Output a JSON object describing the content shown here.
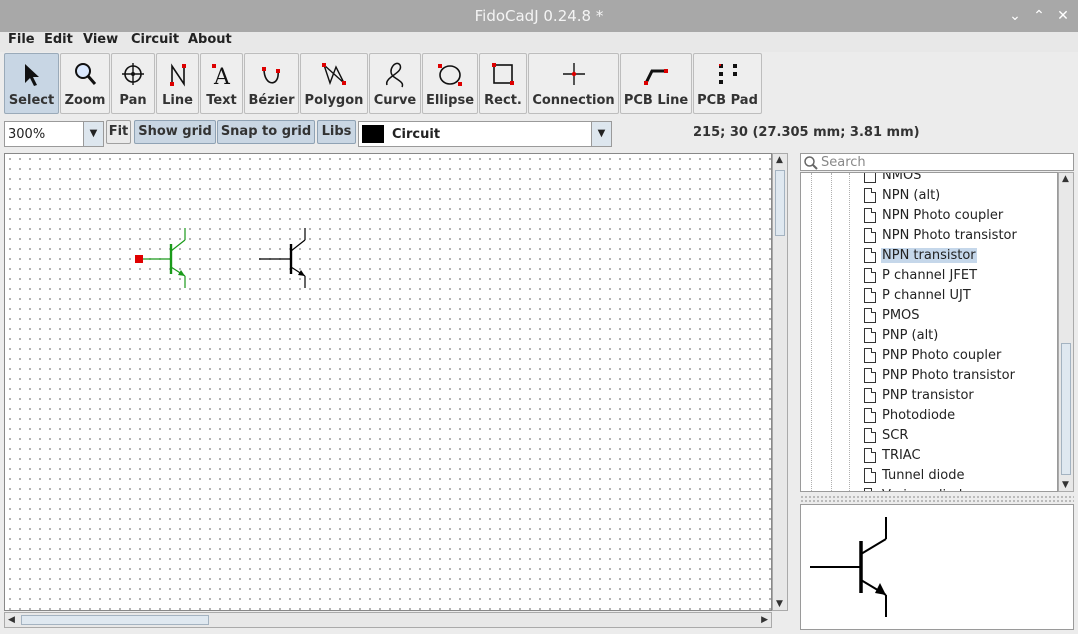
{
  "window": {
    "title": "FidoCadJ 0.24.8  *",
    "buttons": [
      "minimize",
      "maximize",
      "close"
    ]
  },
  "menu": [
    "File",
    "Edit",
    "View",
    "Circuit",
    "About"
  ],
  "toolbar": {
    "tools": [
      {
        "label": "Select",
        "icon": "arrow-cursor-icon",
        "active": true
      },
      {
        "label": "Zoom",
        "icon": "magnifier-icon"
      },
      {
        "label": "Pan",
        "icon": "crosshair-icon"
      },
      {
        "label": "Line",
        "icon": "line-icon"
      },
      {
        "label": "Text",
        "icon": "text-a-icon"
      },
      {
        "label": "Bézier",
        "icon": "bezier-icon"
      },
      {
        "label": "Polygon",
        "icon": "polygon-icon"
      },
      {
        "label": "Curve",
        "icon": "curve-icon"
      },
      {
        "label": "Ellipse",
        "icon": "ellipse-icon"
      },
      {
        "label": "Rect.",
        "icon": "rectangle-icon"
      },
      {
        "label": "Connection",
        "icon": "connection-icon"
      },
      {
        "label": "PCB Line",
        "icon": "pcb-line-icon"
      },
      {
        "label": "PCB Pad",
        "icon": "pcb-pad-icon"
      }
    ]
  },
  "toolbar2": {
    "zoom_value": "300%",
    "fit_label": "Fit",
    "show_grid_label": "Show grid",
    "snap_to_grid_label": "Snap to grid",
    "libs_label": "Libs",
    "layer_value": "Circuit",
    "layer_color": "#000000",
    "coordinates": "215; 30 (27.305 mm; 3.81 mm)"
  },
  "library": {
    "search_placeholder": "Search",
    "items": [
      {
        "label": "NMOS"
      },
      {
        "label": "NPN (alt)"
      },
      {
        "label": "NPN Photo coupler"
      },
      {
        "label": "NPN Photo transistor"
      },
      {
        "label": "NPN transistor",
        "selected": true
      },
      {
        "label": "P channel JFET"
      },
      {
        "label": "P channel UJT"
      },
      {
        "label": "PMOS"
      },
      {
        "label": "PNP (alt)"
      },
      {
        "label": "PNP Photo coupler"
      },
      {
        "label": "PNP Photo transistor"
      },
      {
        "label": "PNP transistor"
      },
      {
        "label": "Photodiode"
      },
      {
        "label": "SCR"
      },
      {
        "label": "TRIAC"
      },
      {
        "label": "Tunnel diode"
      },
      {
        "label": "Varicap diode"
      }
    ]
  },
  "colors": {
    "selection_green": "#1a9a1a",
    "handle_red": "#e00000",
    "selected_item_bg": "#c5d7ea"
  }
}
